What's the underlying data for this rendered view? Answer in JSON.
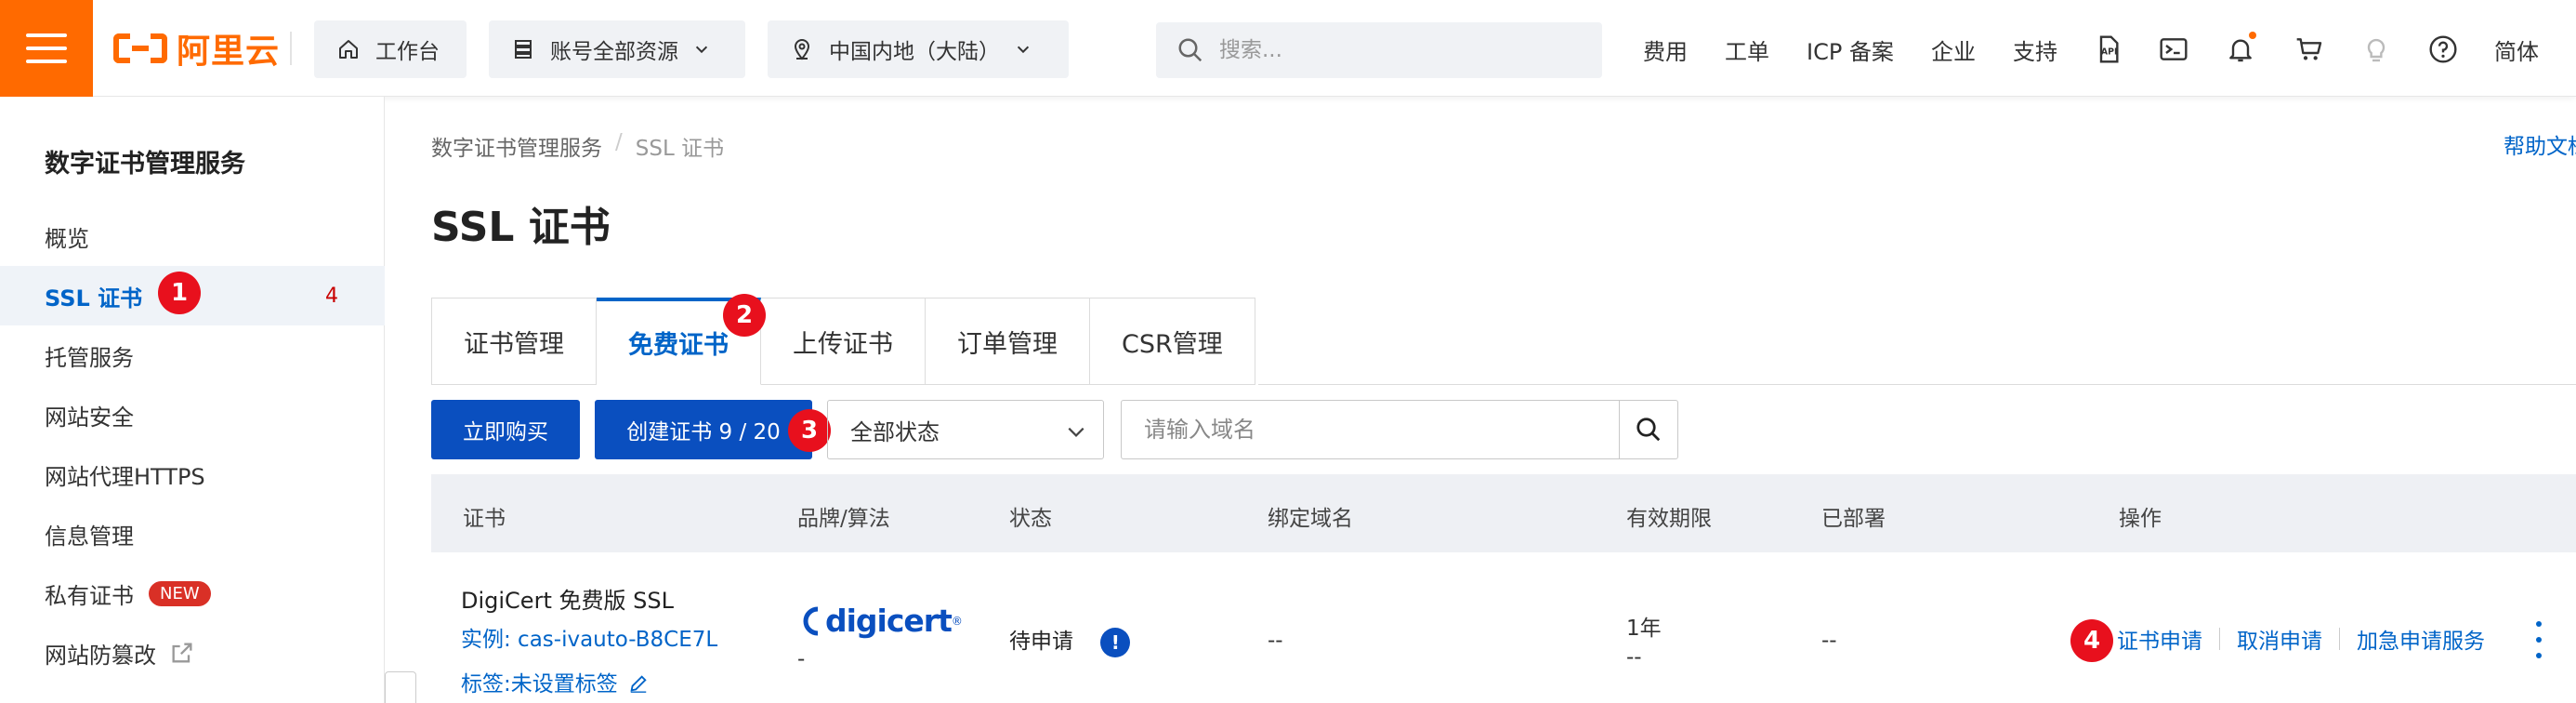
{
  "topbar": {
    "brand": "阿里云",
    "workbench": "工作台",
    "resources": "账号全部资源",
    "region": "中国内地（大陆）",
    "search_placeholder": "搜索...",
    "links": [
      "费用",
      "工单",
      "ICP 备案",
      "企业",
      "支持"
    ],
    "language": "简体",
    "brand_color": "#ff6a00"
  },
  "sidebar": {
    "title": "数字证书管理服务",
    "items": [
      {
        "label": "概览"
      },
      {
        "label": "SSL 证书",
        "count": "4"
      },
      {
        "label": "托管服务"
      },
      {
        "label": "网站安全"
      },
      {
        "label": "网站代理HTTPS"
      },
      {
        "label": "信息管理"
      },
      {
        "label": "私有证书",
        "badge": "NEW"
      },
      {
        "label": "网站防篡改"
      }
    ]
  },
  "steps": [
    "1",
    "2",
    "3",
    "4"
  ],
  "main": {
    "breadcrumb": [
      "数字证书管理服务",
      "/",
      "SSL 证书"
    ],
    "help": "帮助文档",
    "title": "SSL 证书",
    "tabs": [
      "证书管理",
      "免费证书",
      "上传证书",
      "订单管理",
      "CSR管理"
    ],
    "buy_button": "立即购买",
    "create_button": "创建证书 9 / 20",
    "status_select": "全部状态",
    "domain_placeholder": "请输入域名",
    "accent_color": "#0a4fbf"
  },
  "table": {
    "headers": [
      "证书",
      "品牌/算法",
      "状态",
      "绑定域名",
      "有效期限",
      "已部署",
      "操作"
    ],
    "rows": [
      {
        "name": "DigiCert 免费版 SSL",
        "instance": "实例: cas-ivauto-B8CE7L",
        "tag": "标签:未设置标签",
        "brand": "digicert",
        "algo": "-",
        "status": "待申请",
        "domain": "--",
        "validity": "1年",
        "validity_sub": "--",
        "deployed": "--",
        "ops": [
          "证书申请",
          "取消申请",
          "加急申请服务"
        ]
      }
    ]
  }
}
